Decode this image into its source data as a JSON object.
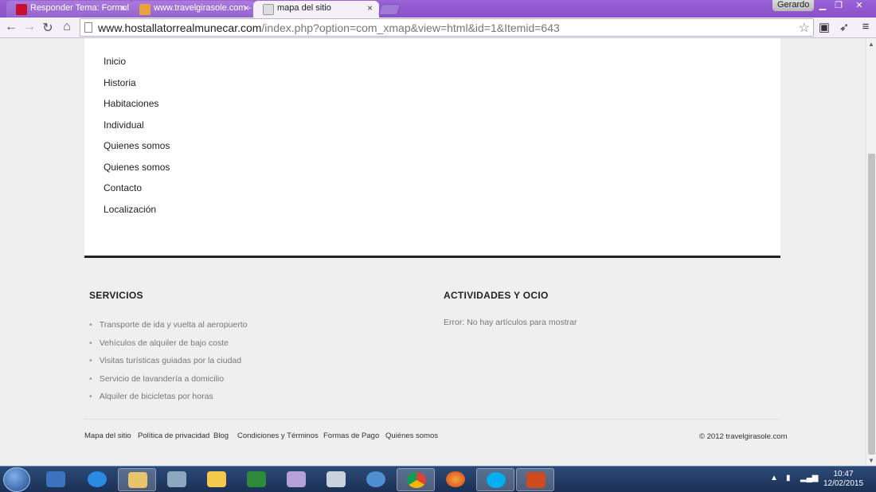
{
  "browser": {
    "tabs": [
      {
        "title": "Responder Tema: Formul",
        "favicon_color": "#c8102e"
      },
      {
        "title": "www.travelgirasole.com -",
        "favicon_color": "#e8a33a"
      },
      {
        "title": "mapa del sitio",
        "favicon_color": "#dddddd"
      }
    ],
    "user": "Gerardo",
    "url_host": "www.hostallatorrealmunecar.com",
    "url_path": "/index.php?option=com_xmap&view=html&id=1&Itemid=643"
  },
  "page": {
    "menu": [
      "Inicio",
      "Historia",
      "Habitaciones",
      "Individual",
      "Quienes somos",
      "Quienes somos",
      "Contacto",
      "Localización"
    ],
    "servicios": {
      "title": "SERVICIOS",
      "items": [
        "Transporte de ida y vuelta al aeropuerto",
        "Vehículos de alquiler de bajo coste",
        "Visitas turísticas guiadas por la ciudad",
        "Servicio de lavandería a domicilio",
        "Alquiler de bicicletas por horas"
      ]
    },
    "actividades": {
      "title": "ACTIVIDADES Y OCIO",
      "message": "Error: No hay artículos para mostrar"
    },
    "footer": {
      "links": [
        "Mapa del sitio",
        "Política de privacidad",
        "Blog",
        "Condiciones y Términos",
        "Formas de Pago",
        "Quiénes somos"
      ],
      "copyright": "© 2012 travelgirasole.com"
    }
  },
  "taskbar": {
    "time": "10:47",
    "date": "12/02/2015",
    "apps": [
      "start",
      "media-player",
      "internet-explorer",
      "file-explorer",
      "tools",
      "outlook",
      "excel",
      "paint",
      "calculator",
      "network",
      "chrome",
      "firefox",
      "skype",
      "presentation"
    ]
  }
}
